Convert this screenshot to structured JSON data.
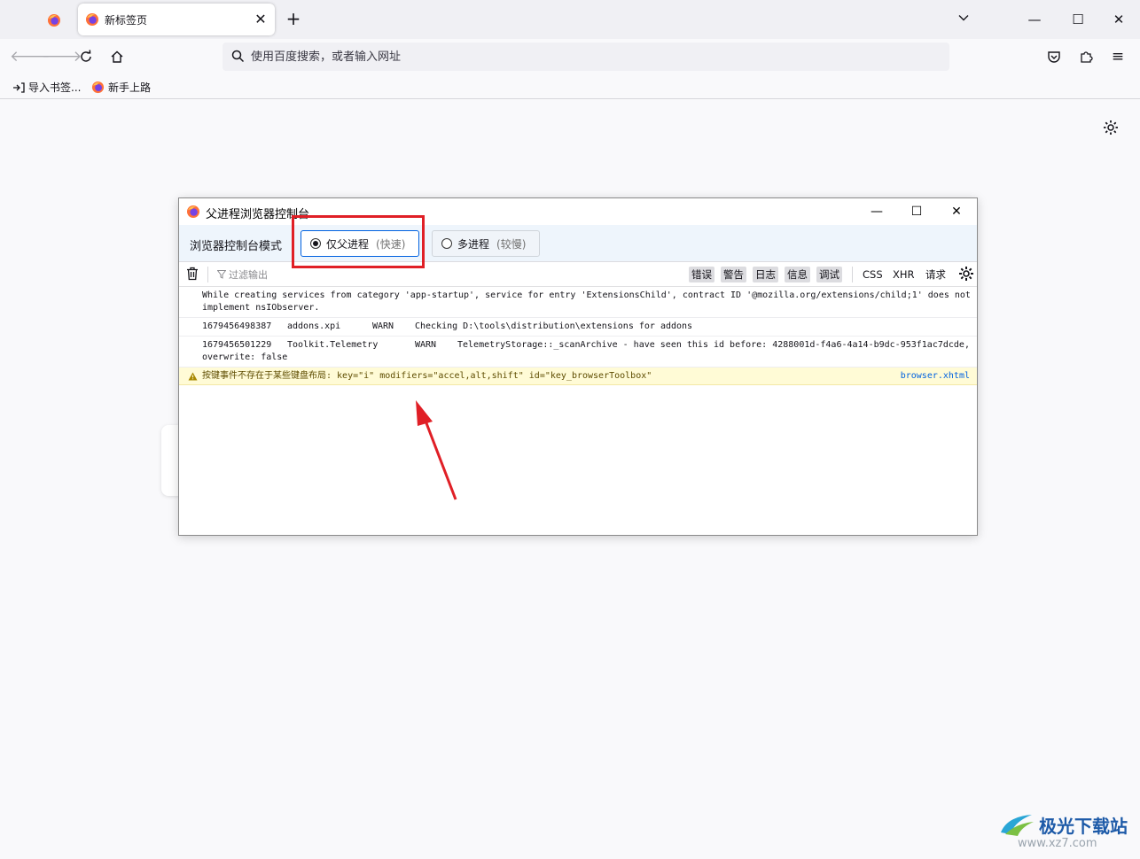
{
  "browser": {
    "tabs": [
      {
        "title": "新标签页"
      }
    ],
    "new_tab_symbol": "+",
    "urlbar": {
      "placeholder": "使用百度搜索，或者输入网址"
    },
    "bookmarks": [
      {
        "label": "导入书签..."
      },
      {
        "label": "新手上路"
      }
    ]
  },
  "console": {
    "title": "父进程浏览器控制台",
    "mode_label": "浏览器控制台模式",
    "modes": [
      {
        "label": "仅父进程",
        "hint": "(快速)",
        "selected": true
      },
      {
        "label": "多进程",
        "hint": "(较慢)",
        "selected": false
      }
    ],
    "filter_placeholder": "过滤输出",
    "filters": [
      {
        "label": "错误",
        "active": true
      },
      {
        "label": "警告",
        "active": true
      },
      {
        "label": "日志",
        "active": true
      },
      {
        "label": "信息",
        "active": true
      },
      {
        "label": "调试",
        "active": true
      },
      {
        "label": "CSS",
        "active": false
      },
      {
        "label": "XHR",
        "active": false
      },
      {
        "label": "请求",
        "active": false
      }
    ],
    "messages": [
      {
        "line1": "While creating services from category 'app-startup', service for entry 'ExtensionsChild', contract ID '@mozilla.org/extensions/child;1' does not",
        "line2": "implement nsIObserver."
      },
      {
        "time": "1679456498387",
        "source": "addons.xpi",
        "level": "WARN",
        "text": "Checking D:\\tools\\distribution\\extensions for addons"
      },
      {
        "time": "1679456501229",
        "source": "Toolkit.Telemetry",
        "level": "WARN",
        "text": "TelemetryStorage::_scanArchive - have seen this id before: 4288001d-f4a6-4a14-b9dc-953f1ac7dcde,",
        "line2": "overwrite: false"
      }
    ],
    "warning": {
      "text": "按键事件不存在于某些键盘布局: key=\"i\" modifiers=\"accel,alt,shift\" id=\"key_browserToolbox\"",
      "source": "browser.xhtml"
    }
  },
  "colors": {
    "highlight": "#e01f26",
    "link": "#0061e0",
    "warning_bg": "#fffbd6"
  },
  "watermark": {
    "name": "极光下载站",
    "url": "www.xz7.com"
  }
}
